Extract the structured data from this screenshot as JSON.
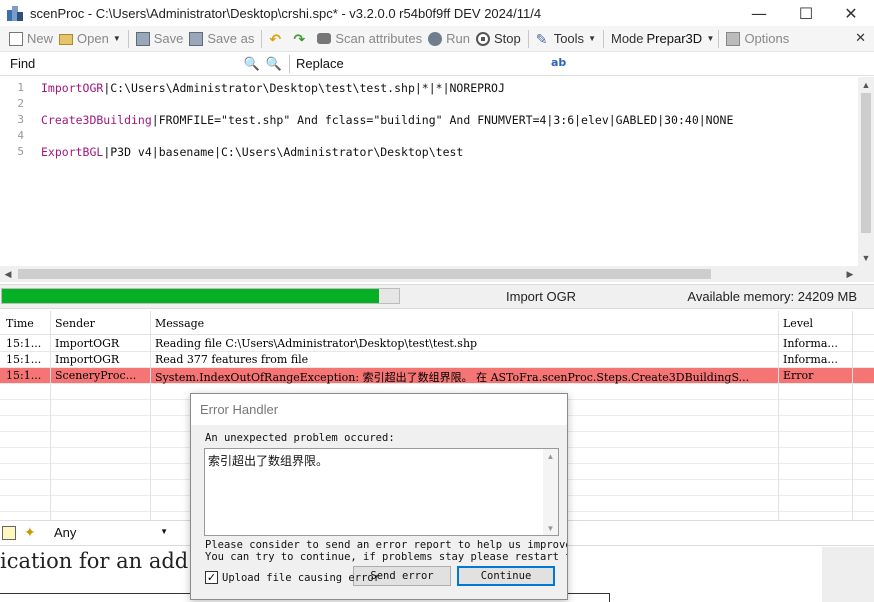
{
  "window": {
    "title": "scenProc - C:\\Users\\Administrator\\Desktop\\crshi.spc* - v3.2.0.0 r54b0f9ff DEV 2024/11/4",
    "minimize": "—",
    "maximize": "☐",
    "close": "✕"
  },
  "toolbar": {
    "new_label": "New",
    "open_label": "Open",
    "save_label": "Save",
    "save_as_label": "Save as",
    "scan_label": "Scan attributes",
    "run_label": "Run",
    "stop_label": "Stop",
    "tools_label": "Tools",
    "mode_label": "Mode",
    "mode_value": "Prepar3D",
    "options_label": "Options",
    "close_x": "✕"
  },
  "findbar": {
    "find_label": "Find",
    "replace_label": "Replace",
    "regex_icon": "ab"
  },
  "editor": {
    "lines": [
      {
        "no": "1",
        "keyword": "ImportOGR",
        "rest": "|C:\\Users\\Administrator\\Desktop\\test\\test.shp|*|*|NOREPROJ"
      },
      {
        "no": "2",
        "keyword": "",
        "rest": ""
      },
      {
        "no": "3",
        "keyword": "Create3DBuilding",
        "rest": "|FROMFILE=\"test.shp\" And fclass=\"building\" And FNUMVERT=4|3:6|elev|GABLED|30:40|NONE"
      },
      {
        "no": "4",
        "keyword": "",
        "rest": ""
      },
      {
        "no": "5",
        "keyword": "ExportBGL",
        "rest": "|P3D v4|basename|C:\\Users\\Administrator\\Desktop\\test"
      }
    ]
  },
  "status": {
    "progress_percent": 95,
    "step": "Import OGR",
    "memory": "Available memory: 24209 MB"
  },
  "log": {
    "headers": [
      "Time",
      "Sender",
      "Message",
      "Level"
    ],
    "rows": [
      {
        "time": "15:1...",
        "sender": "ImportOGR",
        "message": "Reading file C:\\Users\\Administrator\\Desktop\\test\\test.shp",
        "level": "Informa...",
        "error": false
      },
      {
        "time": "15:1...",
        "sender": "ImportOGR",
        "message": "Read 377 features from file",
        "level": "Informa...",
        "error": false
      },
      {
        "time": "15:1...",
        "sender": "SceneryProc...",
        "message": "System.IndexOutOfRangeException: 索引超出了数组界限。   在 ASToFra.scenProc.Steps.Create3DBuildingS...",
        "level": "Error",
        "error": true
      }
    ]
  },
  "filter": {
    "value": "Any"
  },
  "background_doc": {
    "text": "ication for an add"
  },
  "dialog": {
    "title": "Error Handler",
    "label": "An unexpected problem occured:",
    "message": "索引超出了数组界限。",
    "note_line1": "Please consider to send an error report to help us improve th",
    "note_line2": "You can try to continue, if problems stay please restart the",
    "checkbox_label": "Upload file causing error",
    "checkbox_checked": true,
    "send_button": "Send error",
    "continue_button": "Continue"
  }
}
